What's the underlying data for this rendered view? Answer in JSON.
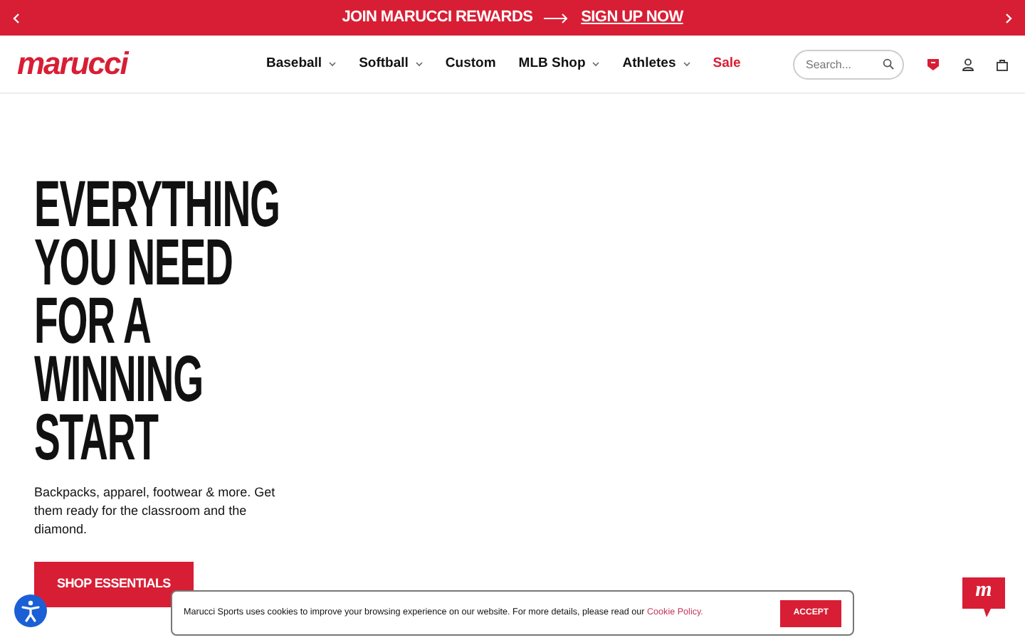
{
  "promo_bar": {
    "text": "JOIN MARUCCI REWARDS",
    "link": "SIGN UP NOW"
  },
  "header": {
    "logo": "marucci",
    "nav": [
      {
        "label": "Baseball",
        "has_menu": true,
        "kind": "normal"
      },
      {
        "label": "Softball",
        "has_menu": true,
        "kind": "normal"
      },
      {
        "label": "Custom",
        "has_menu": false,
        "kind": "normal"
      },
      {
        "label": "MLB Shop",
        "has_menu": true,
        "kind": "normal"
      },
      {
        "label": "Athletes",
        "has_menu": true,
        "kind": "normal"
      },
      {
        "label": "Sale",
        "has_menu": false,
        "kind": "sale"
      }
    ],
    "search": {
      "placeholder": "Search..."
    }
  },
  "hero": {
    "heading_lines": [
      "EVERYTHING",
      "YOU NEED",
      "FOR A",
      "WINNING",
      "START"
    ],
    "text": "Backpacks, apparel, footwear & more. Get them ready for the classroom and the diamond.",
    "button": "SHOP ESSENTIALS"
  },
  "cookie_banner": {
    "text": "Marucci Sports uses cookies to improve your browsing experience on our website. For more details, please read our",
    "link": "Cookie Policy.",
    "button": "ACCEPT"
  },
  "chat": {
    "badge": "m"
  }
}
